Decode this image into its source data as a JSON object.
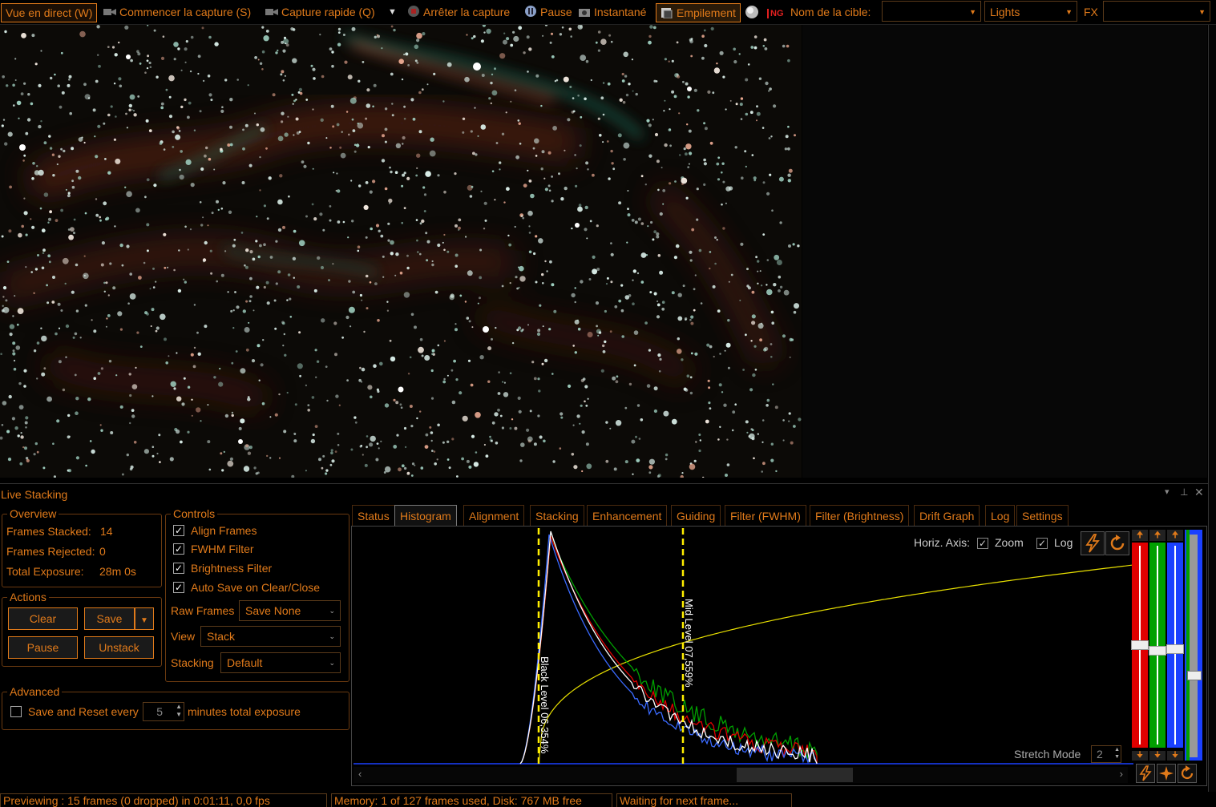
{
  "toolbar": {
    "live_view": "Vue en direct (W)",
    "start_capture": "Commencer la capture (S)",
    "quick_capture": "Capture rapide (Q)",
    "stop_capture": "Arrêter la capture",
    "pause": "Pause",
    "snapshot": "Instantané",
    "stacking": "Empilement",
    "target_name_label": "Nom de la cible:",
    "target_name_value": "",
    "frame_type": "Lights",
    "fx_label": "FX",
    "fx_value": ""
  },
  "panel": {
    "title": "Live Stacking",
    "overview": {
      "title": "Overview",
      "frames_stacked_label": "Frames Stacked:",
      "frames_stacked_value": "14",
      "frames_rejected_label": "Frames Rejected:",
      "frames_rejected_value": "0",
      "total_exposure_label": "Total Exposure:",
      "total_exposure_value": "28m 0s"
    },
    "controls": {
      "title": "Controls",
      "checks": [
        {
          "label": "Align Frames",
          "checked": true
        },
        {
          "label": "FWHM Filter",
          "checked": true
        },
        {
          "label": "Brightness Filter",
          "checked": true
        },
        {
          "label": "Auto Save on Clear/Close",
          "checked": true
        }
      ],
      "raw_frames_label": "Raw Frames",
      "raw_frames_value": "Save None",
      "view_label": "View",
      "view_value": "Stack",
      "stacking_label": "Stacking",
      "stacking_value": "Default"
    },
    "actions": {
      "title": "Actions",
      "clear": "Clear",
      "save": "Save",
      "pause": "Pause",
      "unstack": "Unstack"
    },
    "advanced": {
      "title": "Advanced",
      "save_reset_label": "Save and Reset every",
      "save_reset_value": "5",
      "save_reset_suffix": "minutes total exposure"
    },
    "tabs": [
      "Status",
      "Histogram",
      "Alignment",
      "Stacking",
      "Enhancement",
      "Guiding",
      "Filter (FWHM)",
      "Filter (Brightness)",
      "Drift Graph",
      "Log",
      "Settings"
    ],
    "active_tab": "Histogram",
    "histogram": {
      "horiz_axis_label": "Horiz. Axis:",
      "zoom_label": "Zoom",
      "log_label": "Log",
      "black_level": "Black Level 06,354%",
      "mid_level": "Mid Level 07,559%",
      "stretch_mode_label": "Stretch Mode",
      "stretch_mode_value": "2",
      "slider_levels": {
        "red": 0.5,
        "green": 0.47,
        "blue": 0.48,
        "grey": 0.36
      }
    }
  },
  "status": {
    "previewing": "Previewing : 15 frames (0 dropped) in 0:01:11, 0,0 fps",
    "memory": "Memory: 1 of 127 frames used, Disk: 767 MB free",
    "waiting": "Waiting for next frame..."
  },
  "colors": {
    "accent": "#e07a1a",
    "red": "#e00000",
    "green": "#00a000",
    "blue": "#1a40ff",
    "yellow": "#ffee00"
  }
}
